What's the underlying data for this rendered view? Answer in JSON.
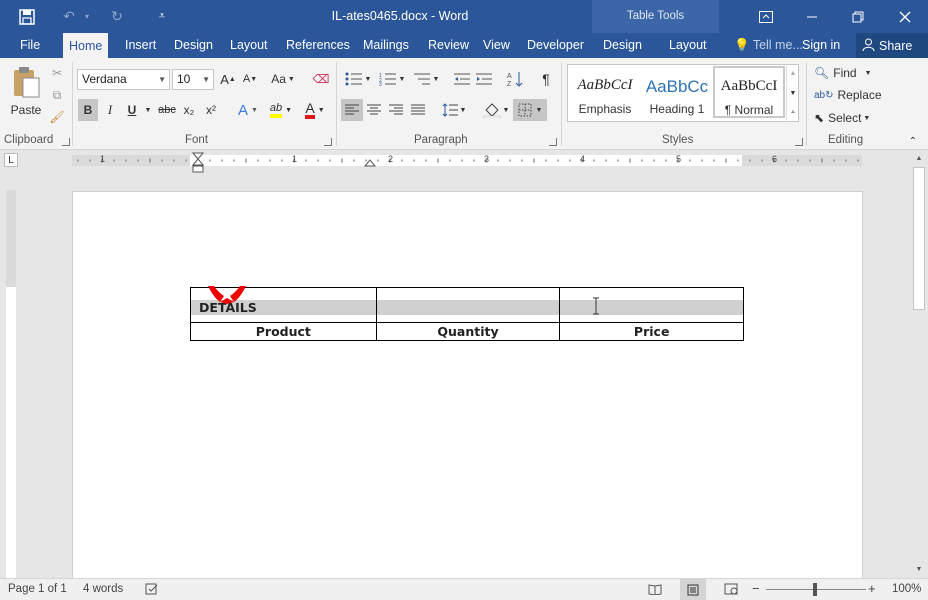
{
  "window": {
    "title": "IL-ates0465.docx - Word",
    "context_label": "Table Tools",
    "accent_color": "#2b579a"
  },
  "qat": {
    "save_icon": "save-icon",
    "undo_icon": "undo-icon",
    "redo_icon": "redo-icon",
    "customize_icon": "customize-qat-icon"
  },
  "tabs": {
    "file": "File",
    "home": "Home",
    "insert": "Insert",
    "design": "Design",
    "layout": "Layout",
    "references": "References",
    "mailings": "Mailings",
    "review": "Review",
    "view": "View",
    "developer": "Developer",
    "table_design": "Design",
    "table_layout": "Layout",
    "tell_me": "Tell me...",
    "sign_in": "Sign in",
    "share": "Share"
  },
  "clipboard": {
    "paste": "Paste",
    "label": "Clipboard"
  },
  "font": {
    "name": "Verdana",
    "size": "10",
    "label": "Font",
    "grow": "A",
    "shrink": "A",
    "case": "Aa",
    "bold": "B",
    "italic": "I",
    "underline": "U",
    "strike": "abc",
    "subscript": "x₂",
    "superscript": "x²",
    "highlight": "ab",
    "color": "A"
  },
  "paragraph": {
    "label": "Paragraph",
    "pilcrow": "¶"
  },
  "styles": {
    "label": "Styles",
    "items": [
      {
        "sample": "AaBbCcI",
        "name": "Emphasis"
      },
      {
        "sample": "AaBbCc",
        "name": "Heading 1"
      },
      {
        "sample": "AaBbCcI",
        "name": "¶ Normal"
      }
    ]
  },
  "editing": {
    "find": "Find",
    "replace": "Replace",
    "select": "Select",
    "label": "Editing"
  },
  "ruler": {
    "numbers": [
      "1",
      "1",
      "2",
      "3",
      "4",
      "5",
      "6"
    ],
    "tab_selector": "L"
  },
  "document": {
    "table": {
      "header": "DETAILS",
      "columns": [
        "Product",
        "Quantity",
        "Price"
      ]
    }
  },
  "status": {
    "page": "Page 1 of 1",
    "words": "4 words",
    "zoom": "100%",
    "zoom_minus": "−",
    "zoom_plus": "+"
  }
}
